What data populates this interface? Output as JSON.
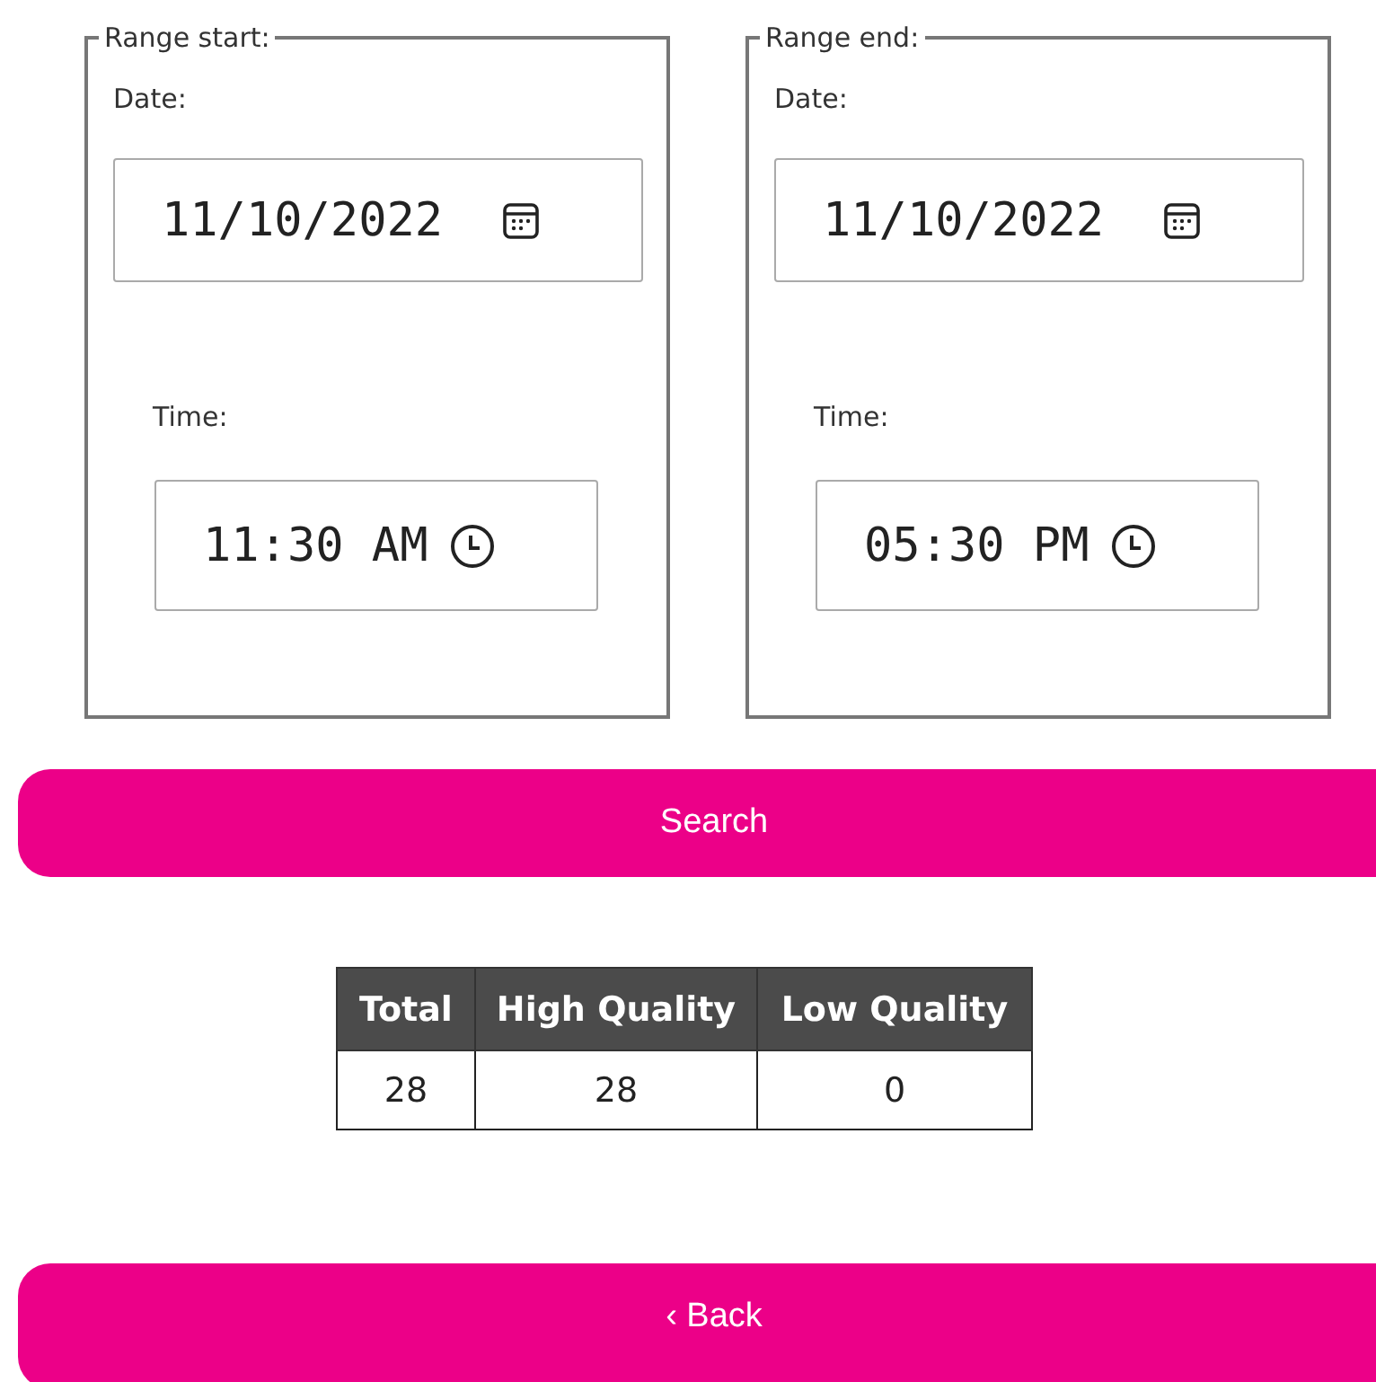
{
  "ranges": [
    {
      "legend": "Range start:",
      "date_label": "Date:",
      "date": "11/10/2022",
      "time_label": "Time:",
      "time": "11:30 AM"
    },
    {
      "legend": "Range end:",
      "date_label": "Date:",
      "date": "11/10/2022",
      "time_label": "Time:",
      "time": "05:30 PM"
    }
  ],
  "search_button": "Search",
  "table": {
    "columns": [
      "Total",
      "High Quality",
      "Low Quality"
    ],
    "rows": [
      [
        "28",
        "28",
        "0"
      ]
    ]
  },
  "back_button": "‹ Back"
}
